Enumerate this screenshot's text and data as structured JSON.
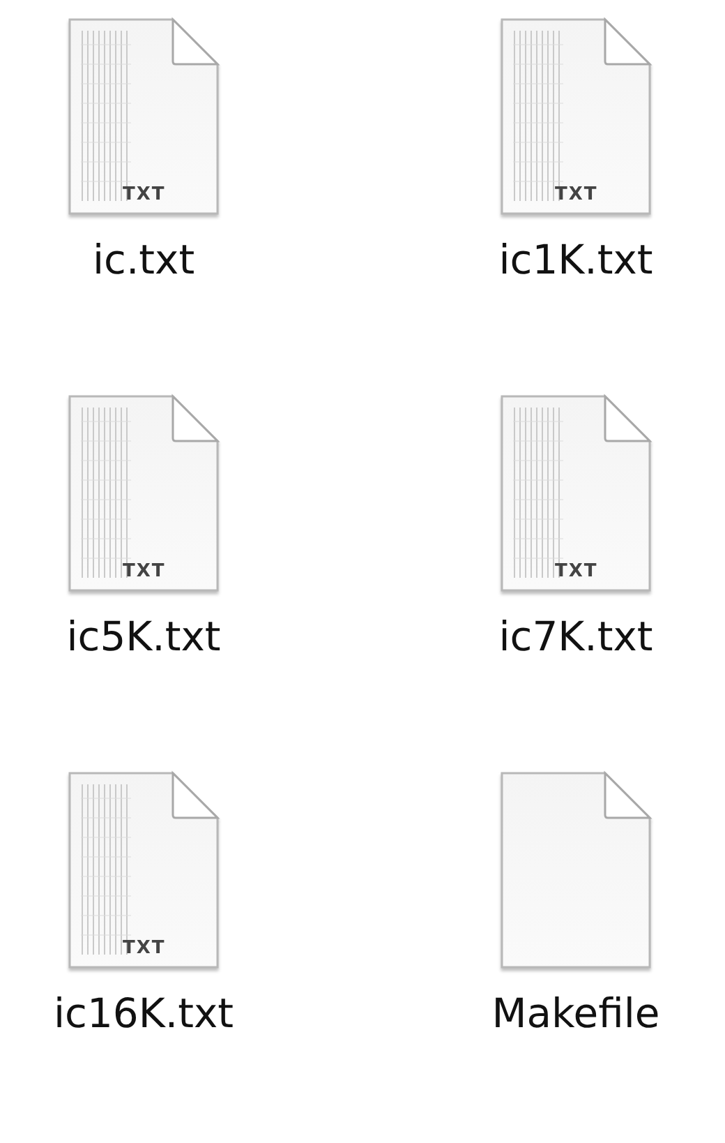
{
  "files": [
    {
      "name": "ic.txt",
      "kind": "text",
      "badge": "TXT"
    },
    {
      "name": "ic1K.txt",
      "kind": "text",
      "badge": "TXT"
    },
    {
      "name": "ic5K.txt",
      "kind": "text",
      "badge": "TXT"
    },
    {
      "name": "ic7K.txt",
      "kind": "text",
      "badge": "TXT"
    },
    {
      "name": "ic16K.txt",
      "kind": "text",
      "badge": "TXT"
    },
    {
      "name": "Makefile",
      "kind": "plain"
    }
  ]
}
